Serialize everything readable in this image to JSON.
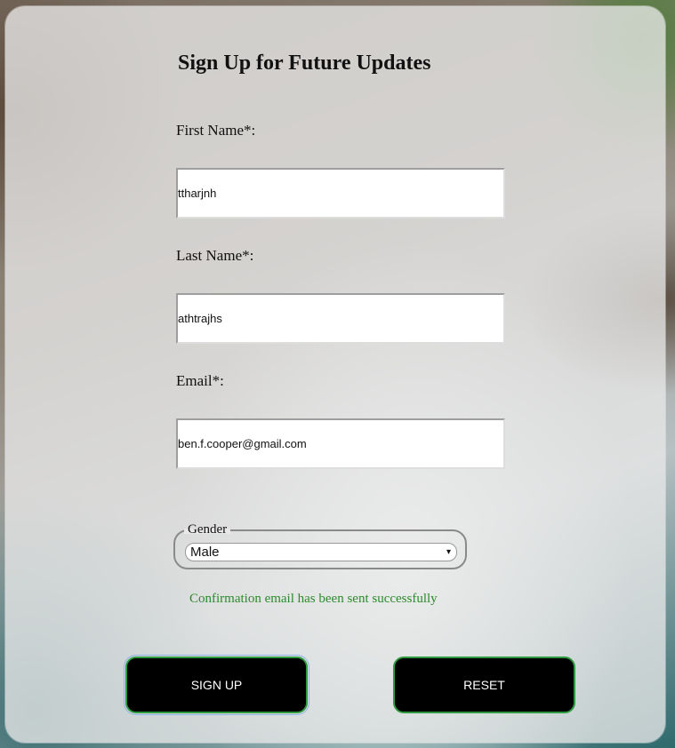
{
  "form": {
    "title": "Sign Up for Future Updates",
    "first_name": {
      "label": "First Name*:",
      "value": "ttharjnh"
    },
    "last_name": {
      "label": "Last Name*:",
      "value": "athtrajhs"
    },
    "email": {
      "label": "Email*:",
      "value": "ben.f.cooper@gmail.com"
    },
    "gender": {
      "legend": "Gender",
      "selected": "Male",
      "caret": "▾"
    },
    "confirmation": "Confirmation email has been sent successfully",
    "buttons": {
      "signup": "SIGN UP",
      "reset": "RESET"
    }
  },
  "colors": {
    "confirmation": "#2c8a2c",
    "button_bg": "#000000",
    "button_border": "#2e9a3f"
  }
}
